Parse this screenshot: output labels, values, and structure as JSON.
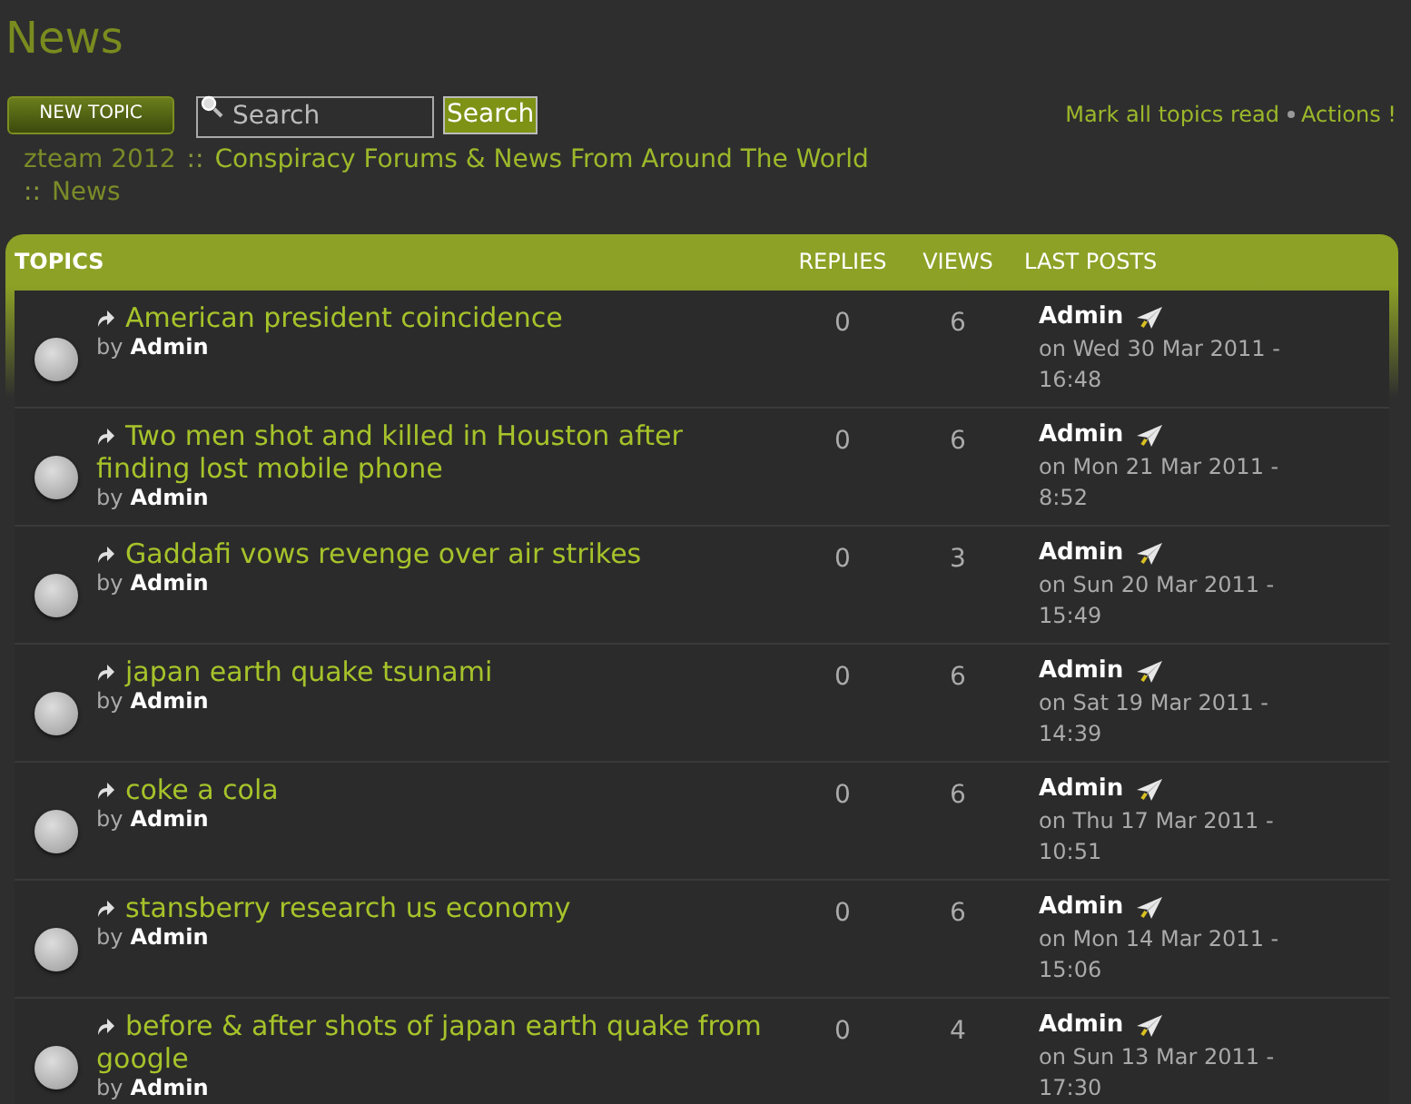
{
  "page_title": "News",
  "new_topic_button": "NEW TOPIC",
  "search": {
    "placeholder": "Search",
    "button": "Search"
  },
  "actions": [
    {
      "label": "Mark all topics read"
    },
    {
      "label": "Actions !"
    }
  ],
  "breadcrumb": {
    "separator": "::",
    "items": [
      {
        "label": "zteam 2012",
        "muted": true
      },
      {
        "label": "Conspiracy Forums & News From Around The World",
        "muted": false
      },
      {
        "label": "News",
        "muted": true
      }
    ]
  },
  "table": {
    "columns": [
      "TOPICS",
      "REPLIES",
      "VIEWS",
      "LAST POSTS"
    ],
    "rows": [
      {
        "title": "American president coincidence",
        "by": "by",
        "author": "Admin",
        "replies": "0",
        "views": "6",
        "last_author": "Admin",
        "last_date": "on Wed 30 Mar 2011 - 16:48"
      },
      {
        "title": "Two men shot and killed in Houston after finding lost mobile phone",
        "by": "by",
        "author": "Admin",
        "replies": "0",
        "views": "6",
        "last_author": "Admin",
        "last_date": "on Mon 21 Mar 2011 - 8:52"
      },
      {
        "title": "Gaddafi vows revenge over air strikes",
        "by": "by",
        "author": "Admin",
        "replies": "0",
        "views": "3",
        "last_author": "Admin",
        "last_date": "on Sun 20 Mar 2011 - 15:49"
      },
      {
        "title": "japan earth quake tsunami",
        "by": "by",
        "author": "Admin",
        "replies": "0",
        "views": "6",
        "last_author": "Admin",
        "last_date": "on Sat 19 Mar 2011 - 14:39"
      },
      {
        "title": "coke a cola",
        "by": "by",
        "author": "Admin",
        "replies": "0",
        "views": "6",
        "last_author": "Admin",
        "last_date": "on Thu 17 Mar 2011 - 10:51"
      },
      {
        "title": "stansberry research us economy",
        "by": "by",
        "author": "Admin",
        "replies": "0",
        "views": "6",
        "last_author": "Admin",
        "last_date": "on Mon 14 Mar 2011 - 15:06"
      },
      {
        "title": "before & after shots of japan earth quake from google",
        "by": "by",
        "author": "Admin",
        "replies": "0",
        "views": "4",
        "last_author": "Admin",
        "last_date": "on Sun 13 Mar 2011 - 17:30"
      }
    ]
  }
}
